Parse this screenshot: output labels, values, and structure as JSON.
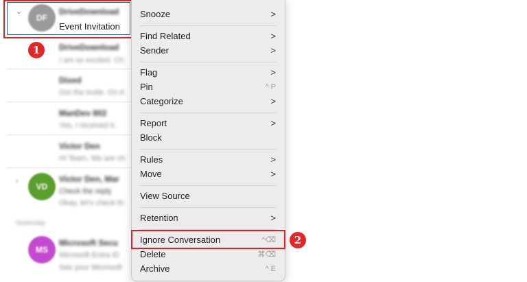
{
  "mail_list": {
    "first_row": {
      "sender": "DriveDownload",
      "subject": "Event Invitation",
      "avatar_initials": "DF"
    },
    "rows": [
      {
        "sender": "DriveDownload",
        "preview": "I am so excited. Ch"
      },
      {
        "sender": "Dixed",
        "preview": "Got the invite. On A"
      },
      {
        "sender": "ManDev 802",
        "preview": "Yes, I received it."
      },
      {
        "sender": "Victor Den",
        "preview": "Hi Team, We are ch"
      },
      {
        "sender": "Victor Den, Mar",
        "preview": "Check the reply",
        "preview2": "Okay, let's check th",
        "avatar_initials": "VD"
      },
      {
        "section": "Yesterday"
      },
      {
        "sender": "Microsoft Secu",
        "preview": "Microsoft Entra ID",
        "preview2": "See your Microsoft",
        "avatar_initials": "MS"
      }
    ]
  },
  "annotations": {
    "step1": "1",
    "step2": "2"
  },
  "menu": {
    "items": [
      {
        "label": "Snooze",
        "arrow": ">"
      },
      {
        "label": "Find Related",
        "arrow": ">"
      },
      {
        "label": "Sender",
        "arrow": ">"
      },
      {
        "label": "Flag",
        "arrow": ">"
      },
      {
        "label": "Pin",
        "shortcut": "^ P"
      },
      {
        "label": "Categorize",
        "arrow": ">"
      },
      {
        "label": "Report",
        "arrow": ">"
      },
      {
        "label": "Block"
      },
      {
        "label": "Rules",
        "arrow": ">"
      },
      {
        "label": "Move",
        "arrow": ">"
      },
      {
        "label": "View Source"
      },
      {
        "label": "Retention",
        "arrow": ">"
      },
      {
        "label": "Ignore Conversation",
        "shortcut": "^⌫"
      },
      {
        "label": "Delete",
        "shortcut": "⌘⌫"
      },
      {
        "label": "Archive",
        "shortcut": "^ E"
      }
    ]
  },
  "colors": {
    "accent_red": "#e02020",
    "green_avatar": "#5a9e2e",
    "purple_avatar": "#c34ad0",
    "gray_avatar": "#9a9a9a"
  }
}
